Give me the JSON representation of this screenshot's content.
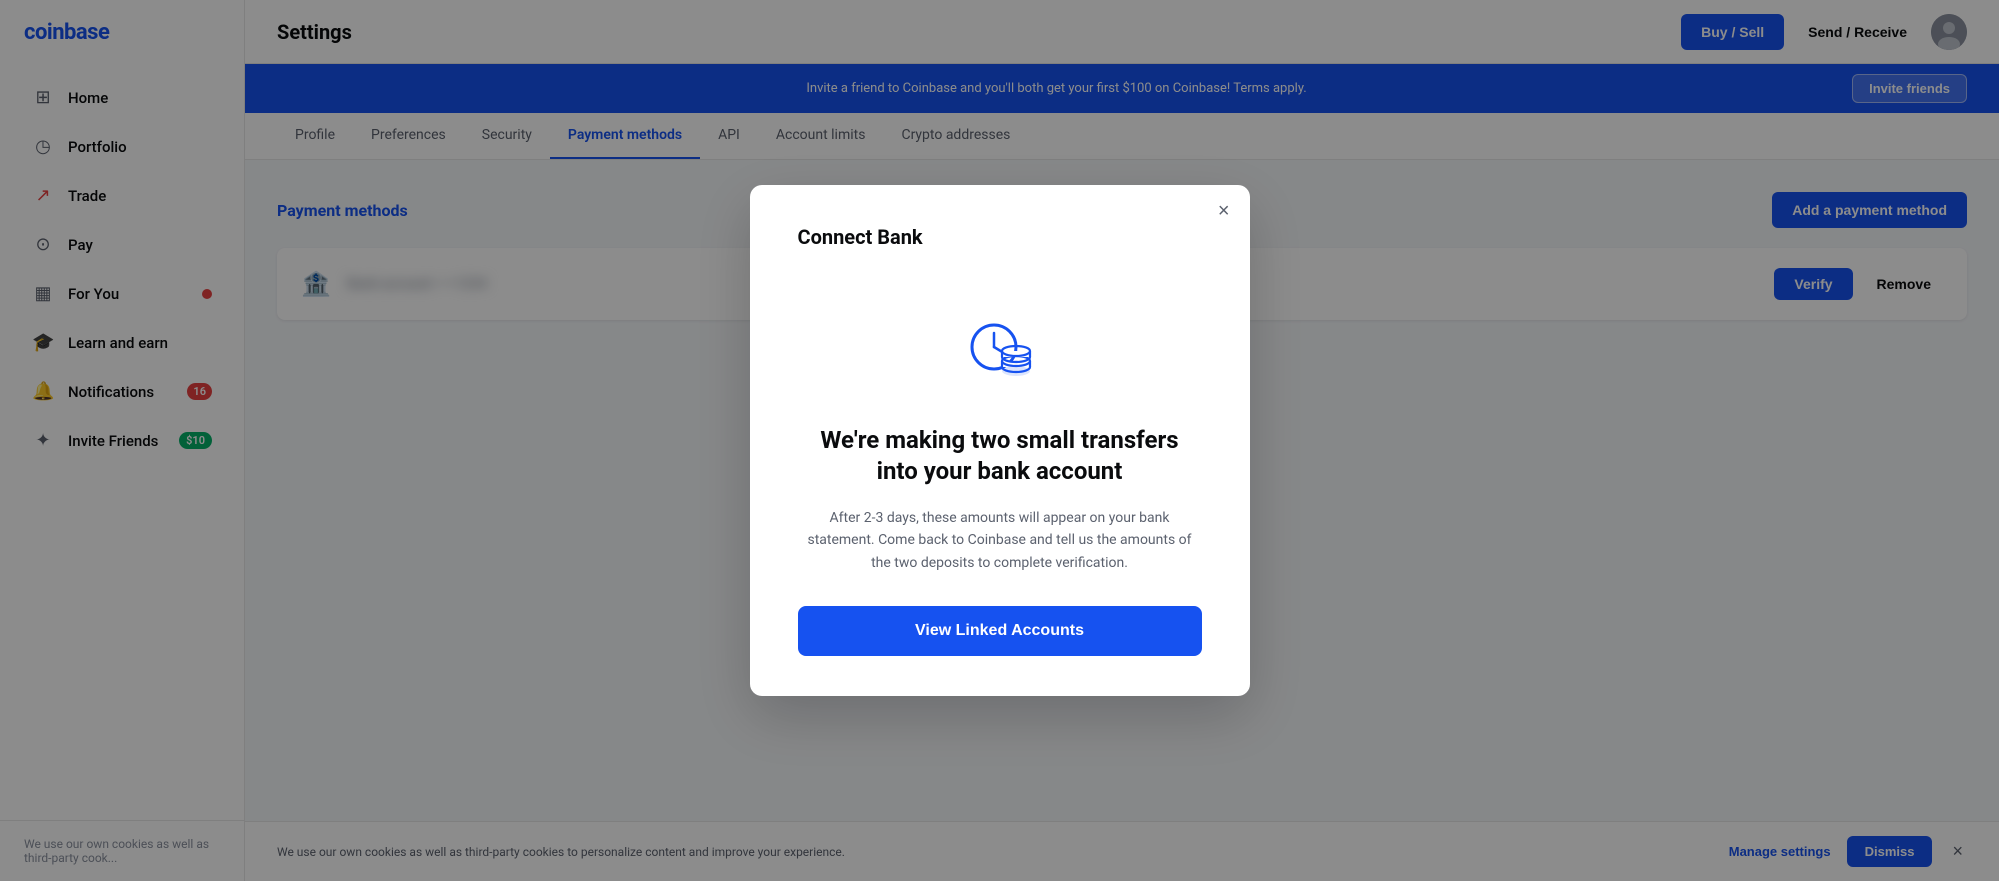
{
  "sidebar": {
    "logo": "coinbase",
    "nav_items": [
      {
        "id": "home",
        "label": "Home",
        "icon": "⊞",
        "badge": null
      },
      {
        "id": "portfolio",
        "label": "Portfolio",
        "icon": "◷",
        "badge": null
      },
      {
        "id": "trade",
        "label": "Trade",
        "icon": "↗",
        "badge": null
      },
      {
        "id": "pay",
        "label": "Pay",
        "icon": "⊙",
        "badge": null
      },
      {
        "id": "for-you",
        "label": "For You",
        "icon": "▦",
        "badge": "●",
        "badge_type": "dot"
      },
      {
        "id": "learn-earn",
        "label": "Learn and earn",
        "icon": "🎓",
        "badge": null
      },
      {
        "id": "notifications",
        "label": "Notifications",
        "icon": "🔔",
        "badge": "16",
        "badge_type": "count"
      },
      {
        "id": "invite-friends",
        "label": "Invite Friends",
        "icon": "✦",
        "badge": "$10",
        "badge_type": "green"
      }
    ],
    "footer_text": "We use our own cookies as well as third-party cook..."
  },
  "header": {
    "title": "Settings",
    "buy_sell_label": "Buy / Sell",
    "send_receive_label": "Send / Receive"
  },
  "banner": {
    "text": "Invite a friend to Coinbase and you'll both get your first $100 on Coinbase! Terms apply.",
    "button_label": "Invite friends"
  },
  "settings_tabs": {
    "tabs": [
      {
        "id": "profile",
        "label": "Profile"
      },
      {
        "id": "preferences",
        "label": "Preferences"
      },
      {
        "id": "security",
        "label": "Security"
      },
      {
        "id": "payment-methods",
        "label": "Payment methods",
        "active": true
      },
      {
        "id": "api",
        "label": "API"
      },
      {
        "id": "account-limits",
        "label": "Account limits"
      },
      {
        "id": "crypto-addresses",
        "label": "Crypto addresses"
      }
    ]
  },
  "payment_methods": {
    "section_title": "Payment methods",
    "add_button_label": "Add a payment method",
    "bank_entry": {
      "bank_name_placeholder": "Bank account ••••",
      "verify_label": "Verify",
      "remove_label": "Remove"
    }
  },
  "modal": {
    "title": "Connect Bank",
    "close_label": "×",
    "heading": "We're making two small transfers into your bank account",
    "body_text": "After 2-3 days, these amounts will appear on your bank statement. Come back to Coinbase and tell us the amounts of the two deposits to complete verification.",
    "cta_label": "View Linked Accounts"
  },
  "cookie_bar": {
    "text": "We use our own cookies as well as third-party cookies to personalize content and improve your experience.",
    "manage_label": "Manage settings",
    "dismiss_label": "Dismiss"
  }
}
